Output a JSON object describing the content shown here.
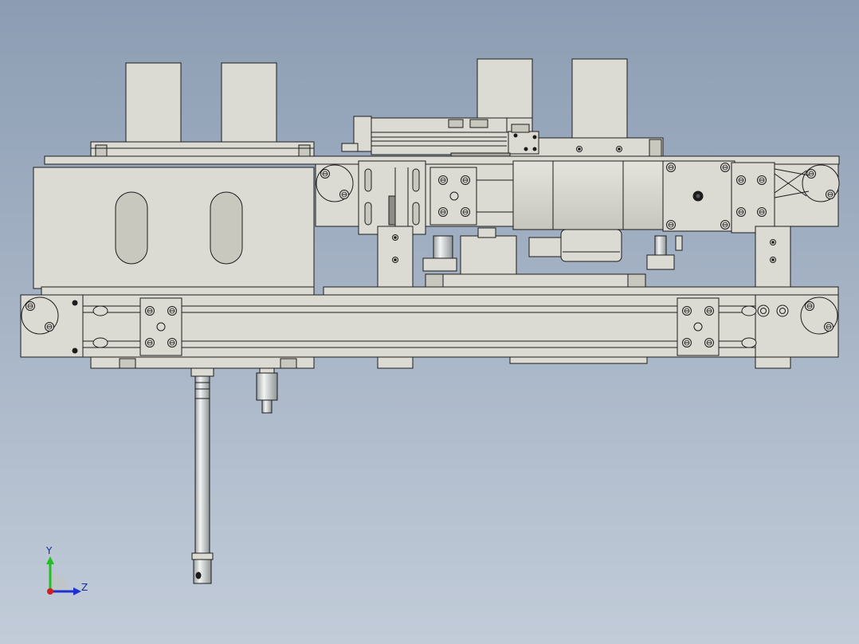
{
  "viewport": {
    "background_top": "#8c9db3",
    "background_bottom": "#c2ccd9"
  },
  "model": {
    "name": "linear-module-assembly",
    "part_fill": "#dcdbd3",
    "part_shade": "#c9c8bf",
    "edge_color": "#1c1c1c",
    "shaft_fill": "#d4d6d6"
  },
  "triad": {
    "y_label": "Y",
    "z_label": "Z",
    "y_color": "#20c020",
    "z_color": "#2030d0",
    "x_color": "#d02020"
  }
}
